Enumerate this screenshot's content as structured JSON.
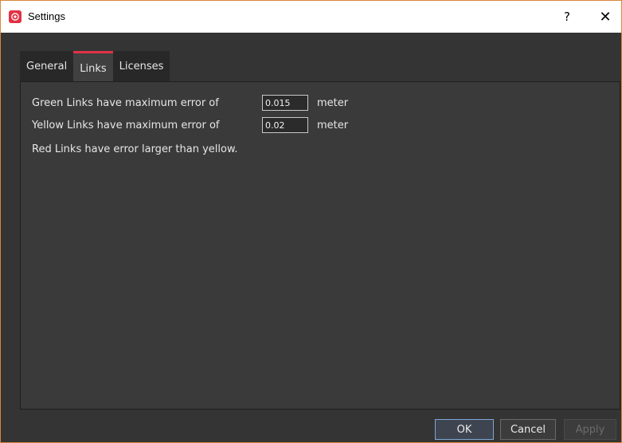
{
  "window": {
    "title": "Settings",
    "help_label": "?",
    "close_label": "✕"
  },
  "tabs": [
    {
      "label": "General",
      "active": false
    },
    {
      "label": "Links",
      "active": true
    },
    {
      "label": "Licenses",
      "active": false
    }
  ],
  "links": {
    "green_label": "Green Links have maximum error of",
    "green_value": "0.015",
    "green_unit": "meter",
    "yellow_label": "Yellow Links have maximum error of",
    "yellow_value": "0.02",
    "yellow_unit": "meter",
    "red_note": "Red Links have error larger than yellow."
  },
  "buttons": {
    "ok": "OK",
    "cancel": "Cancel",
    "apply": "Apply"
  },
  "colors": {
    "accent": "#e23145",
    "background": "#343434"
  }
}
